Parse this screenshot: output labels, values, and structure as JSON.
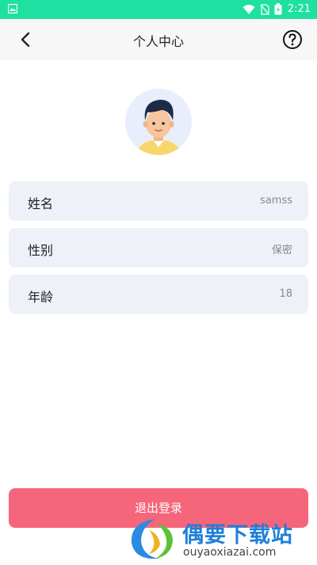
{
  "status_bar": {
    "time": "2:21"
  },
  "header": {
    "title": "个人中心"
  },
  "profile": {
    "rows": [
      {
        "label": "姓名",
        "value": "samss"
      },
      {
        "label": "性别",
        "value": "保密"
      },
      {
        "label": "年龄",
        "value": "18"
      }
    ]
  },
  "logout": {
    "label": "退出登录"
  },
  "watermark": {
    "title": "偶要下载站",
    "url": "ouyaoxiazai.com"
  },
  "colors": {
    "status_bar": "#1ee0a0",
    "row_background": "#eef1f8",
    "logout_button": "#f5667b"
  }
}
